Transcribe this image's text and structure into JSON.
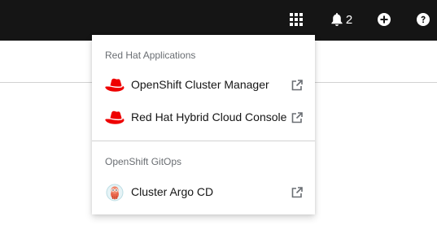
{
  "masthead": {
    "app_launcher_icon": "grid-icon",
    "notifications": {
      "icon": "bell-icon",
      "count": "2"
    },
    "add_icon": "plus-circle-icon",
    "help_icon": "question-circle-icon"
  },
  "app_launcher_menu": {
    "groups": [
      {
        "title": "Red Hat Applications",
        "items": [
          {
            "label": "OpenShift Cluster Manager",
            "icon": "redhat-logo-icon",
            "external": true
          },
          {
            "label": "Red Hat Hybrid Cloud Console",
            "icon": "redhat-logo-icon",
            "external": true
          }
        ]
      },
      {
        "title": "OpenShift GitOps",
        "items": [
          {
            "label": "Cluster Argo CD",
            "icon": "argo-cd-logo-icon",
            "external": true
          }
        ]
      }
    ]
  },
  "colors": {
    "masthead_bg": "#151515",
    "redhat_red": "#ee0000",
    "group_title": "#6a6e73",
    "external_icon": "#6a6e73"
  }
}
